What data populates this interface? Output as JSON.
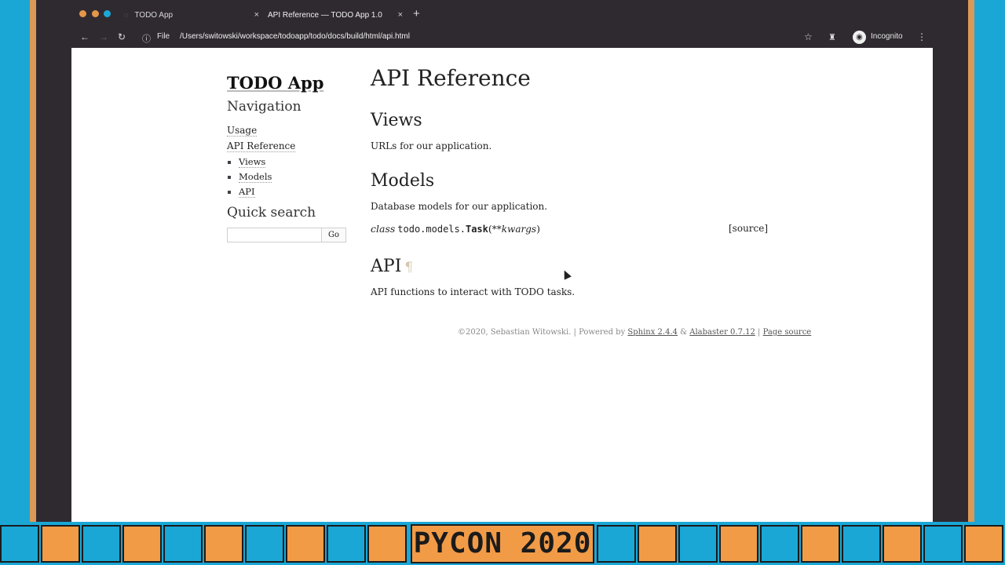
{
  "browser": {
    "tabs": [
      {
        "title": "TODO App",
        "close": "×",
        "active": false
      },
      {
        "title": "API Reference — TODO App 1.0",
        "close": "×",
        "active": true
      }
    ],
    "new_tab": "+",
    "file_label": "File",
    "url": "/Users/switowski/workspace/todoapp/todo/docs/build/html/api.html",
    "incognito": "Incognito"
  },
  "icons": {
    "back": "back-arrow-icon",
    "forward": "forward-arrow-icon",
    "reload": "reload-icon",
    "info": "info-icon",
    "star": "star-icon",
    "extension": "extension-icon",
    "incognito": "incognito-icon",
    "menu": "kebab-menu-icon"
  },
  "sidebar": {
    "logo": "TODO App",
    "nav_heading": "Navigation",
    "items": [
      {
        "label": "Usage"
      },
      {
        "label": "API Reference",
        "children": [
          {
            "label": "Views"
          },
          {
            "label": "Models"
          },
          {
            "label": "API"
          }
        ]
      }
    ],
    "search_heading": "Quick search",
    "search_value": "",
    "search_button": "Go"
  },
  "main": {
    "title": "API Reference",
    "sections": [
      {
        "heading": "Views",
        "text": "URLs for our application."
      },
      {
        "heading": "Models",
        "text": "Database models for our application."
      },
      {
        "heading": "API",
        "text": "API functions to interact with TODO tasks."
      }
    ],
    "classdef": {
      "keyword": "class",
      "module": "todo.models.",
      "name": "Task",
      "open": "(",
      "args": "**kwargs",
      "close": ")",
      "source": "[source]"
    },
    "pilcrow": "¶"
  },
  "footer": {
    "copyright": "©2020, Sebastian Witowski.",
    "sep1": " | Powered by ",
    "sphinx": "Sphinx 2.4.4",
    "amp": " & ",
    "alabaster": "Alabaster 0.7.12",
    "sep2": " | ",
    "page_source": "Page source"
  },
  "banner": {
    "text": "PYCON 2020"
  },
  "colors": {
    "banner_blue": "#1aa7d6",
    "banner_orange": "#f29b47",
    "chrome_dark": "#2f2a30",
    "frame_orange": "#d99a57"
  }
}
